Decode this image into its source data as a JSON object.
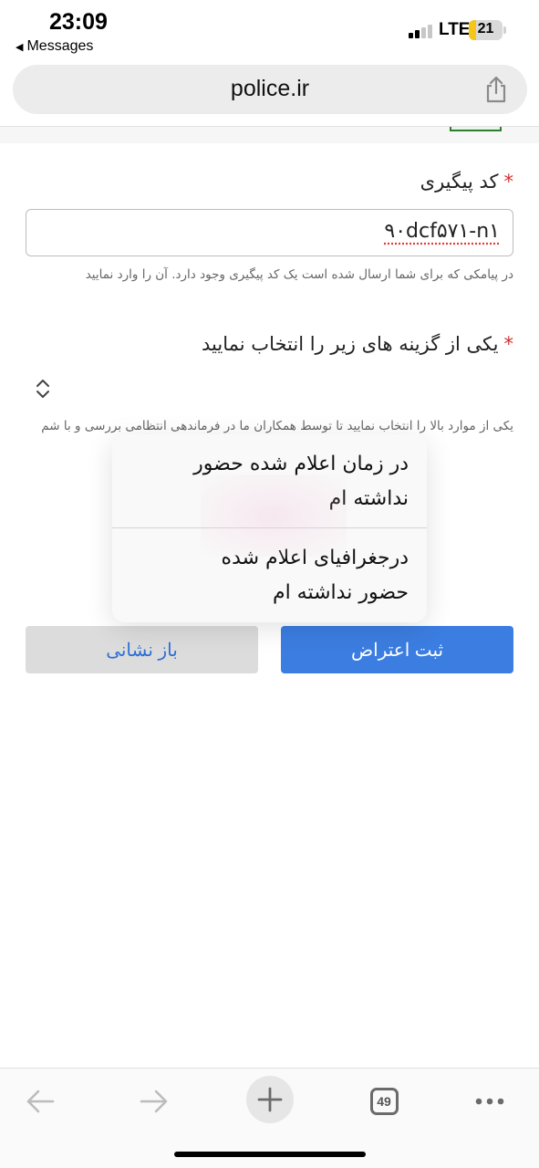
{
  "status_bar": {
    "time": "23:09",
    "back_app": "Messages",
    "network": "LTE",
    "battery_level": "21",
    "battery_color": "#f5c518"
  },
  "browser": {
    "url": "police.ir",
    "share_icon": "share-icon"
  },
  "form": {
    "tracking_code": {
      "label": "کد پیگیری",
      "value": "۹۰dcf۵۷۱-n۱",
      "help": "در پیامکی که برای شما ارسال شده است یک کد پیگیری وجود دارد. آن را وارد نمایید"
    },
    "option_select": {
      "label": "یکی از گزینه های زیر را انتخاب نمایید",
      "help": "یکی از موارد بالا را انتخاب نمایید تا توسط همکاران ما در فرماندهی انتظامی بررسی و با شم"
    },
    "required_mark": "*",
    "submit_label": "ثبت اعتراض",
    "reset_label": "باز نشانی",
    "submit_color": "#3b7de0"
  },
  "dropdown_options": [
    "در زمان اعلام شده حضور نداشته ام",
    "درجغرافیای اعلام شده حضور نداشته ام"
  ],
  "toolbar": {
    "tab_count": "49"
  }
}
